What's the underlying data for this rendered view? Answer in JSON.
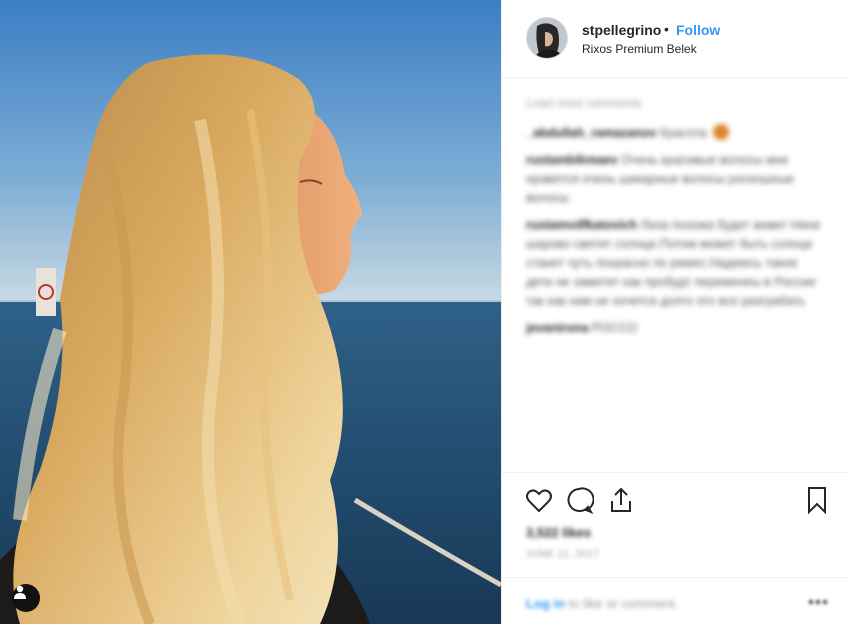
{
  "post": {
    "username": "stpellegrino",
    "separator": "•",
    "follow_label": "Follow",
    "location": "Rixos Premium Belek",
    "avatar_icon": "user-avatar",
    "tag_icon": "user-tag-icon"
  },
  "comments": {
    "load_more": "Load more comments",
    "items": [
      {
        "user": "_abdullah_ramazanov",
        "text": "Красота"
      },
      {
        "user": "rustambikmaev",
        "text": "Очень красивые волосы мне нравятся очень шикарные волосы роскошные волосы"
      },
      {
        "user": "rustamvdfkatovich",
        "text": "Лиза похожа будет живет Нине шарово светит солнце.Потом может быть солнце станет чуть похрасно по ремес.Надеюсь такое дети не заметит как пробудт переменеы в России так как нам не хочется долго это все разграбать"
      },
      {
        "user": "jevanirona",
        "text": "РОССО"
      }
    ]
  },
  "actions": {
    "like_icon": "heart-icon",
    "comment_icon": "comment-icon",
    "share_icon": "share-icon",
    "save_icon": "bookmark-icon",
    "likes": "3,522 likes",
    "date": "JUNE 11, 2017"
  },
  "footer": {
    "login_link": "Log in",
    "login_rest": "to like or comment.",
    "more_icon": "more-options-icon"
  },
  "colors": {
    "accent": "#3897f0",
    "text": "#262626",
    "muted": "#999999",
    "border": "#efefef"
  }
}
